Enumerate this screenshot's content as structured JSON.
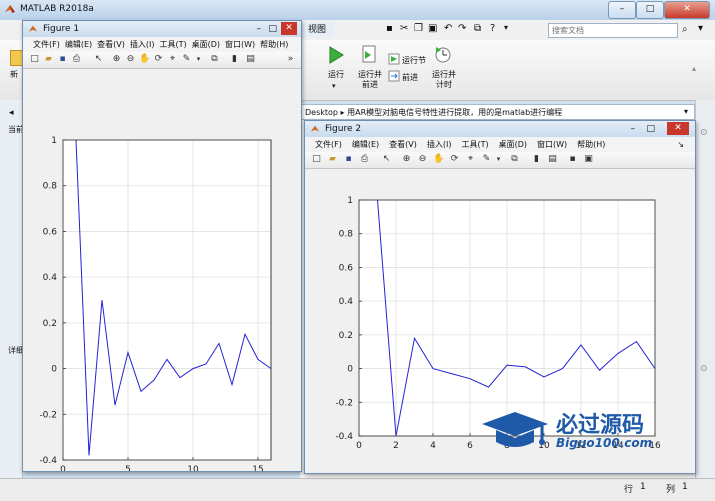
{
  "main_window": {
    "title": "MATLAB R2018a",
    "tabs": [
      "视图"
    ],
    "search_placeholder": "搜索文档",
    "ribbon": {
      "new_label": "新",
      "run_label": "运行",
      "run_advance_label_1": "运行并",
      "run_advance_label_2": "前进",
      "run_section_label": "运行节",
      "advance_label": "前进",
      "run_time_label_1": "运行并",
      "run_time_label_2": "计时"
    },
    "path_text": "Desktop ▸ 用AR模型对脑电信号特性进行提取，用的是matlab进行编程",
    "left_labels": [
      "当前",
      "详细"
    ],
    "status": {
      "row_label": "行",
      "row_value": "1",
      "col_label": "列",
      "col_value": "1"
    }
  },
  "figure1": {
    "title": "Figure 1",
    "menus": [
      "文件(F)",
      "编辑(E)",
      "查看(V)",
      "插入(I)",
      "工具(T)",
      "桌面(D)",
      "窗口(W)",
      "帮助(H)"
    ],
    "yticks": [
      "1",
      "0.8",
      "0.6",
      "0.4",
      "0.2",
      "0",
      "-0.2",
      "-0.4"
    ],
    "xticks": [
      "0",
      "5",
      "10",
      "15"
    ]
  },
  "figure2": {
    "title": "Figure 2",
    "menus": [
      "文件(F)",
      "编辑(E)",
      "查看(V)",
      "插入(I)",
      "工具(T)",
      "桌面(D)",
      "窗口(W)",
      "帮助(H)"
    ],
    "yticks": [
      "1",
      "0.8",
      "0.6",
      "0.4",
      "0.2",
      "0",
      "-0.2",
      "-0.4"
    ],
    "xticks": [
      "0",
      "2",
      "4",
      "6",
      "8",
      "10",
      "12",
      "14",
      "16"
    ]
  },
  "watermark": {
    "brand": "必过源码",
    "url": "Biguo100.com"
  },
  "colors": {
    "line": "#2323d6",
    "grid": "#e0e0e0",
    "title_bar": "#c8dbee"
  },
  "chart_data": [
    {
      "type": "line",
      "x": [
        1,
        2,
        3,
        4,
        5,
        6,
        7,
        8,
        9,
        10,
        11,
        12,
        13,
        14,
        15,
        16
      ],
      "series": [
        {
          "values": [
            1.0,
            -0.38,
            0.3,
            -0.16,
            0.07,
            -0.1,
            -0.05,
            0.04,
            -0.04,
            0.0,
            0.02,
            0.11,
            -0.07,
            0.15,
            0.04,
            0.0
          ]
        }
      ],
      "xlim": [
        0,
        16
      ],
      "ylim": [
        -0.4,
        1
      ],
      "xticks": [
        0,
        5,
        10,
        15
      ],
      "yticks": [
        -0.4,
        -0.2,
        0,
        0.2,
        0.4,
        0.6,
        0.8,
        1
      ],
      "grid": true
    },
    {
      "type": "line",
      "x": [
        1,
        2,
        3,
        4,
        5,
        6,
        7,
        8,
        9,
        10,
        11,
        12,
        13,
        14,
        15,
        16
      ],
      "series": [
        {
          "values": [
            1.0,
            -0.4,
            0.18,
            0.0,
            -0.03,
            -0.06,
            -0.11,
            0.02,
            0.01,
            -0.05,
            0.0,
            0.14,
            -0.01,
            0.09,
            0.16,
            0.0
          ]
        }
      ],
      "xlim": [
        0,
        16
      ],
      "ylim": [
        -0.4,
        1
      ],
      "xticks": [
        0,
        2,
        4,
        6,
        8,
        10,
        12,
        14,
        16
      ],
      "yticks": [
        -0.4,
        -0.2,
        0,
        0.2,
        0.4,
        0.6,
        0.8,
        1
      ],
      "grid": true
    }
  ]
}
